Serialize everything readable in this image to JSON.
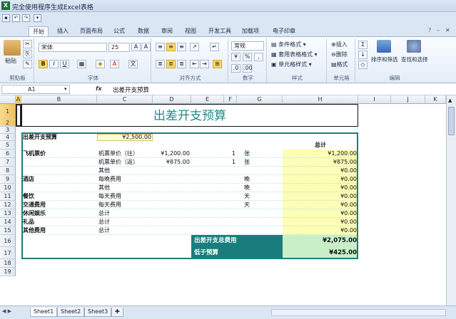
{
  "window": {
    "title": "完全使用程序生成Excel表格",
    "app_icon": "excel-icon"
  },
  "ribbon_tabs": [
    "开始",
    "插入",
    "页面布局",
    "公式",
    "数据",
    "审阅",
    "视图",
    "开发工具",
    "加载项",
    "电子印章"
  ],
  "ribbon": {
    "paste": "粘贴",
    "font_name": "宋体",
    "font_size": "25",
    "number_format": "常规",
    "cond_format": "条件格式",
    "table_format": "套用表格格式",
    "cell_style": "单元格样式",
    "insert": "插入",
    "delete": "删除",
    "format": "格式",
    "sort_filter": "排序和筛选",
    "find_select": "查找和选择",
    "groups": [
      "剪贴板",
      "字体",
      "对齐方式",
      "数字",
      "样式",
      "单元格",
      "编辑"
    ]
  },
  "formula_bar": {
    "name_box": "A1",
    "fx": "fx",
    "value": "出差开支预算"
  },
  "columns": [
    "A",
    "B",
    "C",
    "D",
    "E",
    "F",
    "G",
    "H",
    "I",
    "J",
    "K"
  ],
  "rows": [
    "1",
    "2",
    "3",
    "4",
    "5",
    "6",
    "7",
    "8",
    "9",
    "10",
    "11",
    "12",
    "13",
    "14",
    "15",
    "16",
    "17",
    "18",
    "19"
  ],
  "sheet": {
    "title": "出差开支预算",
    "budget_label": "出差开支预算",
    "budget_value": "¥2,500.00",
    "total_header": "总计",
    "items": [
      {
        "cat": "飞机票价",
        "sub": "机票单价（往）",
        "price": "¥1,200.00",
        "qty": "1",
        "unit": "张",
        "total": "¥1,200.00"
      },
      {
        "cat": "",
        "sub": "机票单价（返）",
        "price": "¥875.00",
        "qty": "1",
        "unit": "张",
        "total": "¥875.00"
      },
      {
        "cat": "",
        "sub": "其他",
        "price": "",
        "qty": "",
        "unit": "",
        "total": "¥0.00"
      },
      {
        "cat": "酒店",
        "sub": "每晚费用",
        "price": "",
        "qty": "",
        "unit": "晚",
        "total": "¥0.00"
      },
      {
        "cat": "",
        "sub": "其他",
        "price": "",
        "qty": "",
        "unit": "晚",
        "total": "¥0.00"
      },
      {
        "cat": "餐饮",
        "sub": "每天费用",
        "price": "",
        "qty": "",
        "unit": "天",
        "total": "¥0.00"
      },
      {
        "cat": "交通费用",
        "sub": "每天费用",
        "price": "",
        "qty": "",
        "unit": "天",
        "total": "¥0.00"
      },
      {
        "cat": "休闲娱乐",
        "sub": "总计",
        "price": "",
        "qty": "",
        "unit": "",
        "total": "¥0.00"
      },
      {
        "cat": "礼品",
        "sub": "总计",
        "price": "",
        "qty": "",
        "unit": "",
        "total": "¥0.00"
      },
      {
        "cat": "其他费用",
        "sub": "总计",
        "price": "",
        "qty": "",
        "unit": "",
        "total": "¥0.00"
      }
    ],
    "total_expense_label": "出差开支总费用",
    "total_expense_value": "¥2,075.00",
    "under_budget_label": "低于预算",
    "under_budget_value": "¥425.00"
  },
  "sheet_tabs": [
    "Sheet1",
    "Sheet2",
    "Sheet3"
  ],
  "colors": {
    "teal": "#1a7d7d",
    "title_teal": "#1f8a8a",
    "yellow": "#fdfdb4"
  }
}
